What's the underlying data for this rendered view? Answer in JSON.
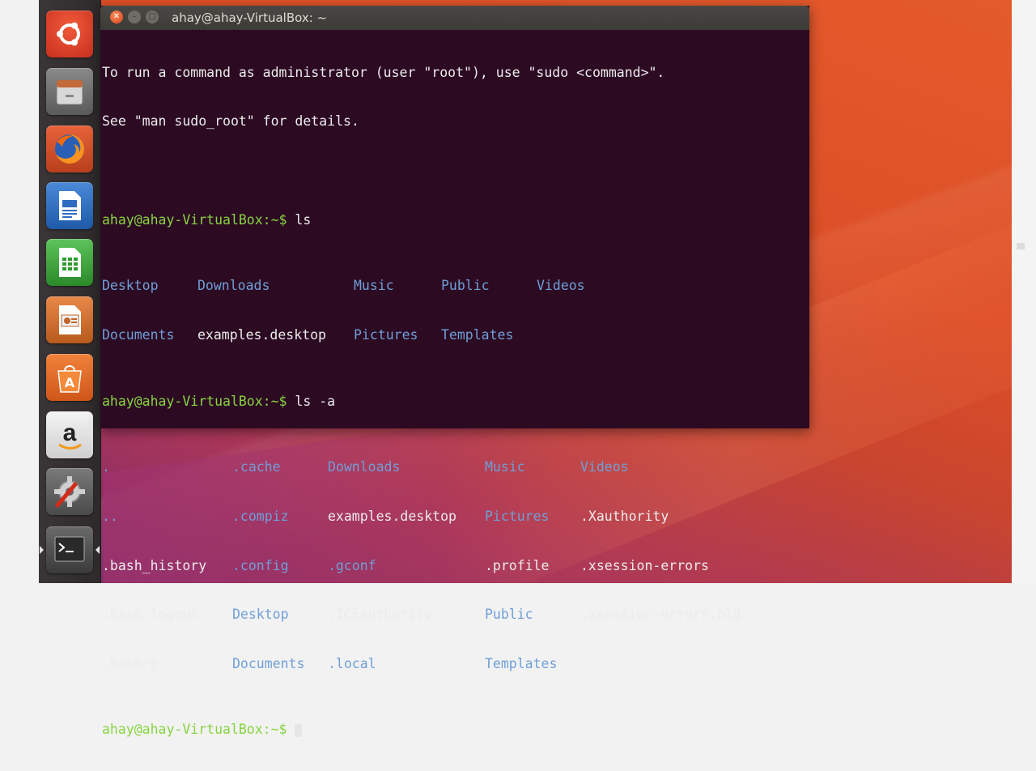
{
  "window": {
    "title": "ahay@ahay-VirtualBox: ~"
  },
  "launcher": {
    "items": [
      {
        "name": "Search your computer",
        "icon": "ubuntu-dash-icon"
      },
      {
        "name": "Files",
        "icon": "files-cabinet-icon"
      },
      {
        "name": "Firefox Web Browser",
        "icon": "firefox-icon"
      },
      {
        "name": "LibreOffice Writer",
        "icon": "writer-document-icon"
      },
      {
        "name": "LibreOffice Calc",
        "icon": "calc-spreadsheet-icon"
      },
      {
        "name": "LibreOffice Impress",
        "icon": "impress-presentation-icon"
      },
      {
        "name": "Ubuntu Software",
        "icon": "software-bag-icon"
      },
      {
        "name": "Amazon",
        "icon": "amazon-icon"
      },
      {
        "name": "System Settings",
        "icon": "settings-gear-icon"
      },
      {
        "name": "Terminal",
        "icon": "terminal-icon"
      }
    ]
  },
  "terminal": {
    "motd_1": "To run a command as administrator (user \"root\"), use \"sudo <command>\".",
    "motd_2": "See \"man sudo_root\" for details.",
    "prompt": "ahay@ahay-VirtualBox:~$",
    "cmd1": " ls",
    "cmd2": " ls -a",
    "ls_output": [
      [
        {
          "text": "Desktop",
          "type": "dir"
        },
        {
          "text": "Downloads",
          "type": "dir"
        },
        {
          "text": "Music",
          "type": "dir"
        },
        {
          "text": "Public",
          "type": "dir"
        },
        {
          "text": "Videos",
          "type": "dir"
        }
      ],
      [
        {
          "text": "Documents",
          "type": "dir"
        },
        {
          "text": "examples.desktop",
          "type": "file"
        },
        {
          "text": "Pictures",
          "type": "dir"
        },
        {
          "text": "Templates",
          "type": "dir"
        }
      ]
    ],
    "ls_a_output": [
      [
        {
          "text": ".",
          "type": "dir"
        },
        {
          "text": ".cache",
          "type": "dir"
        },
        {
          "text": "Downloads",
          "type": "dir"
        },
        {
          "text": "Music",
          "type": "dir"
        },
        {
          "text": "Videos",
          "type": "dir"
        }
      ],
      [
        {
          "text": "..",
          "type": "dir"
        },
        {
          "text": ".compiz",
          "type": "dir"
        },
        {
          "text": "examples.desktop",
          "type": "file"
        },
        {
          "text": "Pictures",
          "type": "dir"
        },
        {
          "text": ".Xauthority",
          "type": "file"
        }
      ],
      [
        {
          "text": ".bash_history",
          "type": "file"
        },
        {
          "text": ".config",
          "type": "dir"
        },
        {
          "text": ".gconf",
          "type": "dir"
        },
        {
          "text": ".profile",
          "type": "file"
        },
        {
          "text": ".xsession-errors",
          "type": "file"
        }
      ],
      [
        {
          "text": ".bash_logout",
          "type": "file"
        },
        {
          "text": "Desktop",
          "type": "dir"
        },
        {
          "text": ".ICEauthority",
          "type": "file"
        },
        {
          "text": "Public",
          "type": "dir"
        },
        {
          "text": ".xsession-errors.old",
          "type": "file"
        }
      ],
      [
        {
          "text": ".bashrc",
          "type": "file"
        },
        {
          "text": "Documents",
          "type": "dir"
        },
        {
          "text": ".local",
          "type": "dir"
        },
        {
          "text": "Templates",
          "type": "dir"
        }
      ]
    ]
  },
  "colors": {
    "prompt": "#87d442",
    "directory": "#6f9fd8",
    "terminal_bg": "#2c0a22",
    "launcher_bg": "#2e2a2c"
  }
}
